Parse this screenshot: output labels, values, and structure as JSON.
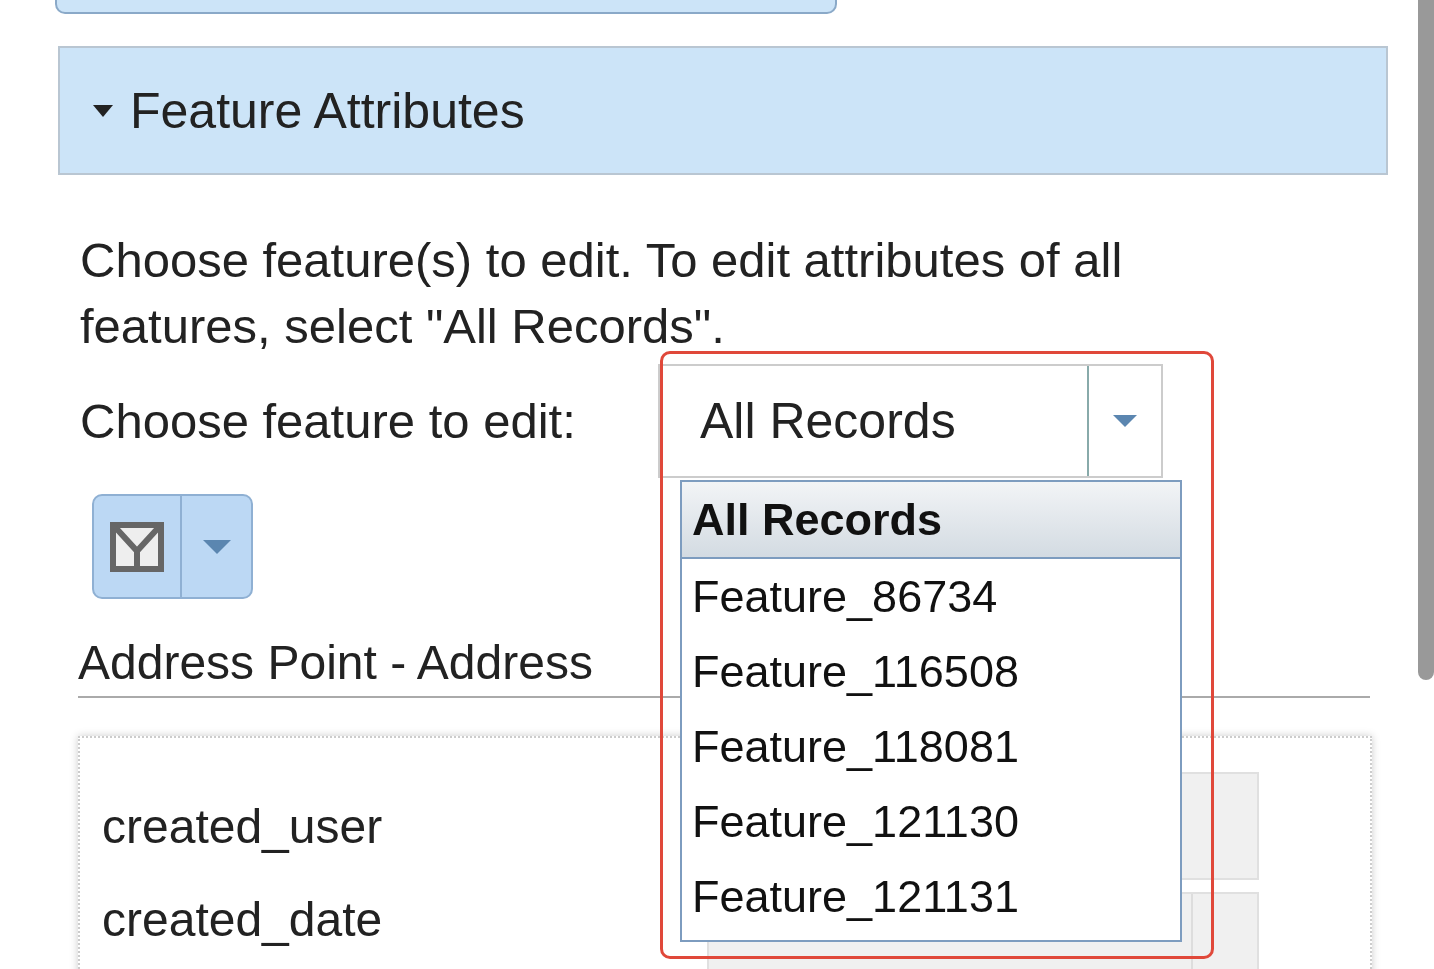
{
  "panel": {
    "title": "Feature Attributes",
    "expanded": true
  },
  "instructions": "Choose feature(s) to edit. To edit attributes of all features, select \"All Records\".",
  "feature_picker": {
    "label": "Choose feature to edit:",
    "value": "All Records",
    "open": true,
    "options": [
      {
        "label": "All Records",
        "selected": true
      },
      {
        "label": "Feature_86734",
        "selected": false
      },
      {
        "label": "Feature_116508",
        "selected": false
      },
      {
        "label": "Feature_118081",
        "selected": false
      },
      {
        "label": "Feature_121130",
        "selected": false
      },
      {
        "label": "Feature_121131",
        "selected": false
      }
    ]
  },
  "layer_heading": "Address Point - Address",
  "fields": [
    {
      "label": "created_user",
      "kind": "text"
    },
    {
      "label": "created_date",
      "kind": "date"
    }
  ]
}
